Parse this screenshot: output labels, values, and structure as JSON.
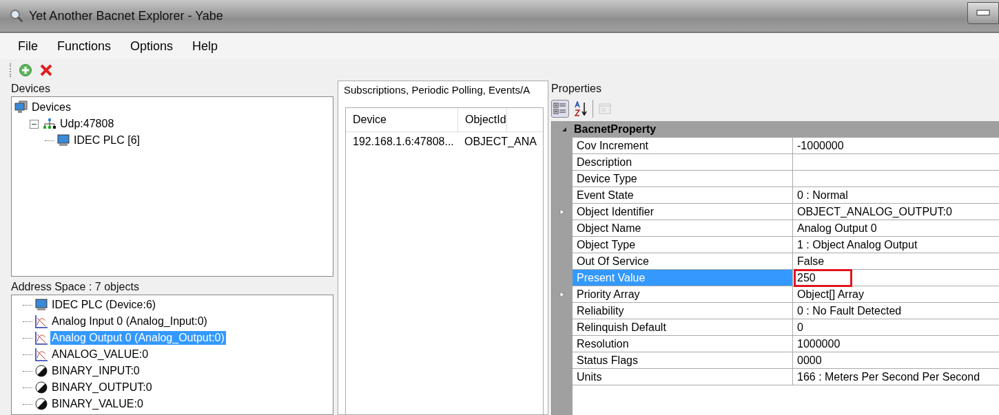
{
  "window": {
    "title": "Yet Another Bacnet Explorer - Yabe"
  },
  "menu": [
    "File",
    "Functions",
    "Options",
    "Help"
  ],
  "devices_panel": {
    "title": "Devices",
    "tree": [
      {
        "label": "Devices",
        "kind": "devices",
        "children": [
          {
            "label": "Udp:47808",
            "kind": "network",
            "expanded": true,
            "children": [
              {
                "label": "IDEC PLC [6]",
                "kind": "device"
              }
            ]
          }
        ]
      }
    ]
  },
  "address_space": {
    "title": "Address Space : 7 objects",
    "items": [
      {
        "label": "IDEC PLC (Device:6)",
        "kind": "device",
        "selected": false
      },
      {
        "label": "Analog Input 0 (Analog_Input:0)",
        "kind": "analog",
        "selected": false
      },
      {
        "label": "Analog Output 0 (Analog_Output:0)",
        "kind": "analog",
        "selected": true
      },
      {
        "label": "ANALOG_VALUE:0",
        "kind": "analog",
        "selected": false
      },
      {
        "label": "BINARY_INPUT:0",
        "kind": "binary",
        "selected": false
      },
      {
        "label": "BINARY_OUTPUT:0",
        "kind": "binary",
        "selected": false
      },
      {
        "label": "BINARY_VALUE:0",
        "kind": "binary",
        "selected": false
      }
    ]
  },
  "subscriptions": {
    "tab": "Subscriptions, Periodic Polling, Events/A",
    "columns": [
      "Device",
      "ObjectId"
    ],
    "rows": [
      [
        "192.168.1.6:47808...",
        "OBJECT_ANA"
      ]
    ]
  },
  "properties": {
    "title": "Properties",
    "category": "BacnetProperty",
    "rows": [
      {
        "name": "Cov Increment",
        "value": "-1000000",
        "expandable": false,
        "selected": false,
        "highlighted": false
      },
      {
        "name": "Description",
        "value": "",
        "expandable": false,
        "selected": false,
        "highlighted": false
      },
      {
        "name": "Device Type",
        "value": "",
        "expandable": false,
        "selected": false,
        "highlighted": false
      },
      {
        "name": "Event State",
        "value": "0 : Normal",
        "expandable": false,
        "selected": false,
        "highlighted": false
      },
      {
        "name": "Object Identifier",
        "value": "OBJECT_ANALOG_OUTPUT:0",
        "expandable": true,
        "selected": false,
        "highlighted": false
      },
      {
        "name": "Object Name",
        "value": "Analog Output 0",
        "expandable": false,
        "selected": false,
        "highlighted": false
      },
      {
        "name": "Object Type",
        "value": "1 : Object Analog Output",
        "expandable": false,
        "selected": false,
        "highlighted": false
      },
      {
        "name": "Out Of Service",
        "value": "False",
        "expandable": false,
        "selected": false,
        "highlighted": false
      },
      {
        "name": "Present Value",
        "value": "250",
        "expandable": false,
        "selected": true,
        "highlighted": true
      },
      {
        "name": "Priority Array",
        "value": "Object[] Array",
        "expandable": true,
        "selected": false,
        "highlighted": false
      },
      {
        "name": "Reliability",
        "value": "0 : No Fault Detected",
        "expandable": false,
        "selected": false,
        "highlighted": false
      },
      {
        "name": "Relinquish Default",
        "value": "0",
        "expandable": false,
        "selected": false,
        "highlighted": false
      },
      {
        "name": "Resolution",
        "value": "1000000",
        "expandable": false,
        "selected": false,
        "highlighted": false
      },
      {
        "name": "Status Flags",
        "value": "0000",
        "expandable": false,
        "selected": false,
        "highlighted": false
      },
      {
        "name": "Units",
        "value": "166 : Meters Per Second Per Second",
        "expandable": false,
        "selected": false,
        "highlighted": false
      }
    ]
  }
}
